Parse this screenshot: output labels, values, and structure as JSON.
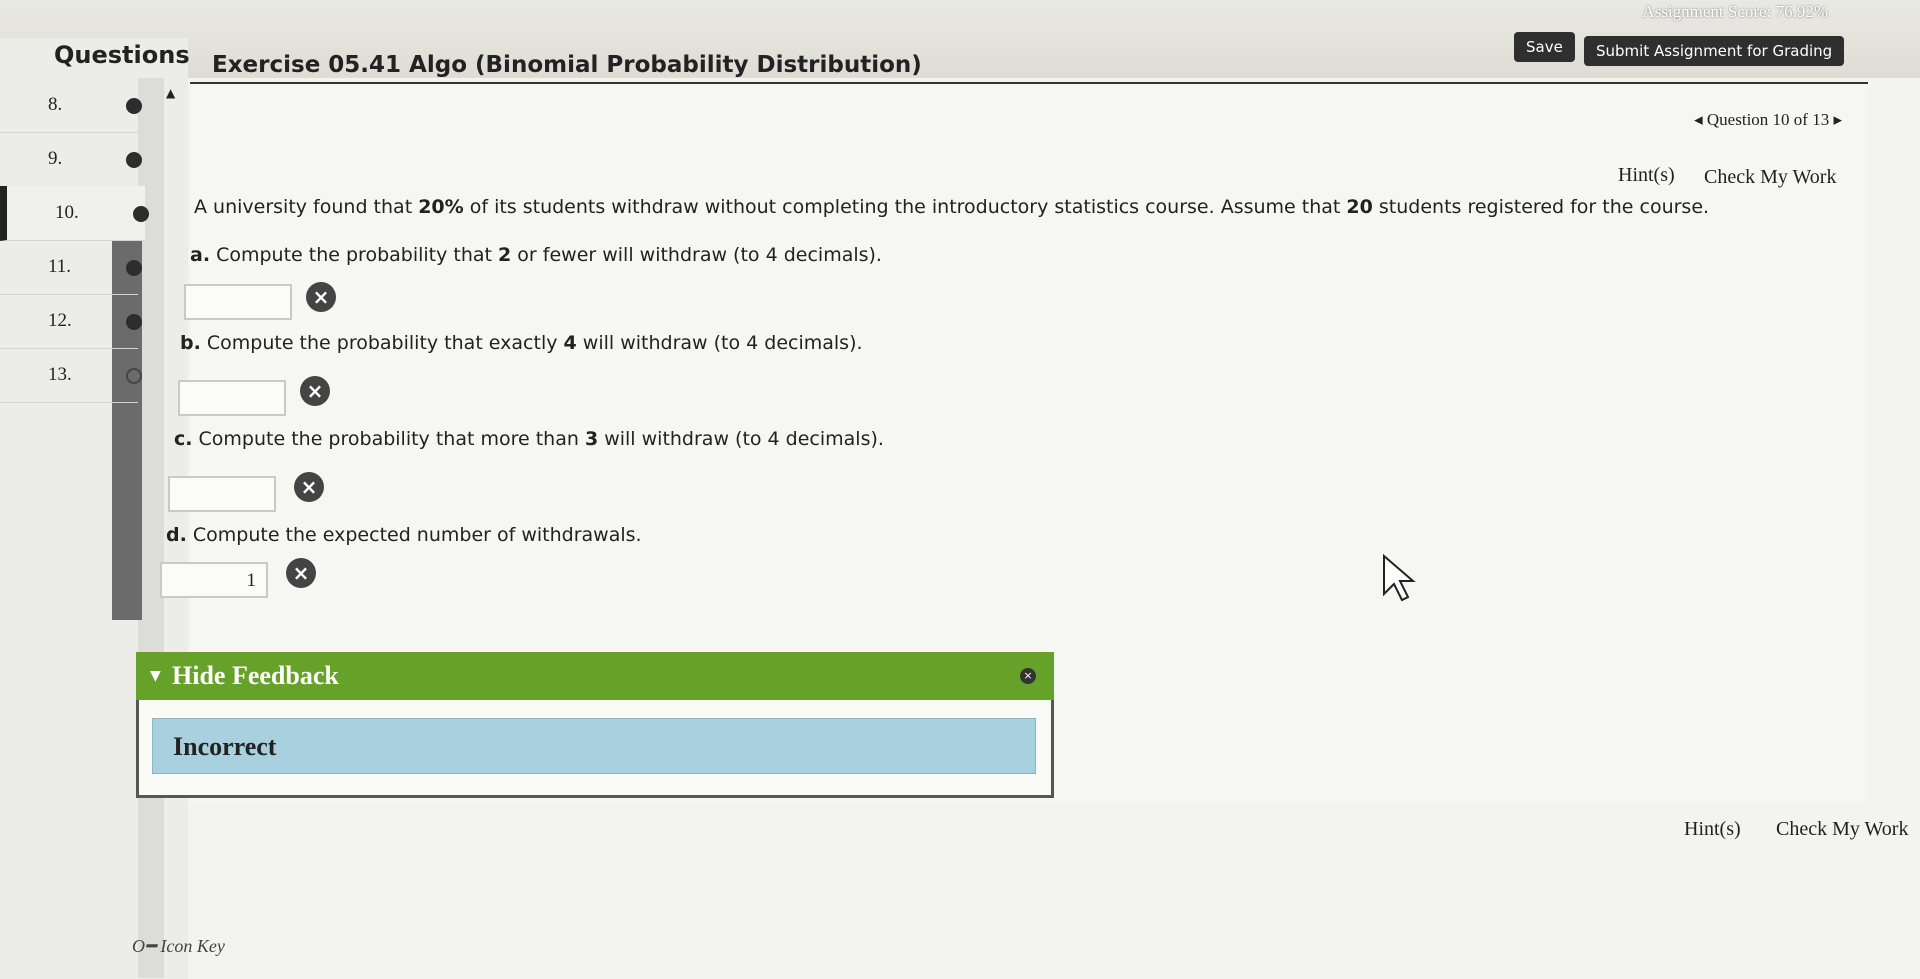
{
  "header": {
    "assignment_score": "Assignment Score: 76.92%",
    "save_label": "Save",
    "submit_label": "Submit Assignment for Grading"
  },
  "sidebar": {
    "title": "Questions",
    "items": [
      {
        "num": "8.",
        "status": "complete"
      },
      {
        "num": "9.",
        "status": "complete"
      },
      {
        "num": "10.",
        "status": "incorrect"
      },
      {
        "num": "11.",
        "status": "complete"
      },
      {
        "num": "12.",
        "status": "complete"
      },
      {
        "num": "13.",
        "status": "unanswered"
      }
    ]
  },
  "exercise": {
    "title": "Exercise 05.41 Algo (Binomial Probability Distribution)",
    "question_nav": "Question 10 of 13",
    "hints_label": "Hint(s)",
    "check_label": "Check My Work",
    "stem_prefix": "A university found that ",
    "stem_pct": "20%",
    "stem_mid": " of its students withdraw without completing the introductory statistics course. Assume that ",
    "stem_n": "20",
    "stem_suffix": " students registered for the course.",
    "parts": [
      {
        "letter": "a.",
        "pre": " Compute the probability that ",
        "bold": "2",
        "post": " or fewer will withdraw (to 4 decimals).",
        "answer": ""
      },
      {
        "letter": "b.",
        "pre": " Compute the probability that exactly ",
        "bold": "4",
        "post": " will withdraw (to 4 decimals).",
        "answer": ""
      },
      {
        "letter": "c.",
        "pre": " Compute the probability that more than ",
        "bold": "3",
        "post": " will withdraw (to 4 decimals).",
        "answer": ""
      },
      {
        "letter": "d.",
        "pre": " Compute the expected number of withdrawals.",
        "bold": "",
        "post": "",
        "answer": "1"
      }
    ]
  },
  "feedback": {
    "toggle_label": "Hide Feedback",
    "result": "Incorrect"
  },
  "footer": {
    "hints_label": "Hint(s)",
    "check_label": "Check My Work",
    "icon_key": "Icon Key"
  },
  "colors": {
    "feedback_green": "#66a22a",
    "incorrect_blue": "#a8d0de"
  }
}
